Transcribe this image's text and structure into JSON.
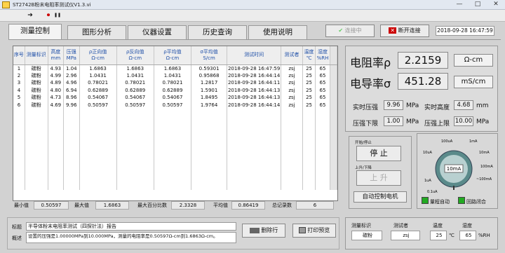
{
  "window": {
    "title": "ST2742B粉末电阻率测试仪V1.3.vi",
    "min": "—",
    "max": "□",
    "close": "✕"
  },
  "toolbar": {
    "run": "➔",
    "record": "⏺",
    "pause": "❚❚"
  },
  "tabs": [
    {
      "label": "测量控制",
      "active": true
    },
    {
      "label": "图形分析",
      "active": false
    },
    {
      "label": "仪器设置",
      "active": false
    },
    {
      "label": "历史查询",
      "active": false
    },
    {
      "label": "使用说明",
      "active": false
    }
  ],
  "connect_btn": "连接中",
  "disconnect_btn": "断开连接",
  "datetime": "2018-09-28 16:47:59",
  "table": {
    "headers": [
      "序号",
      "测量标识",
      "高度\nmm",
      "压强\nMPa",
      "ρ正向值\nΩ-cm",
      "ρ反向值\nΩ-cm",
      "ρ平均值\nΩ-cm",
      "σ平均值\nS/cm",
      "测试时间",
      "测试者",
      "温度\n℃",
      "湿度\n%RH"
    ],
    "rows": [
      [
        "1",
        "碳粉",
        "4.93",
        "1.04",
        "1.6863",
        "1.6863",
        "1.6863",
        "0.59301",
        "2018-09-28 16:47:59",
        "zsj",
        "25",
        "65"
      ],
      [
        "2",
        "碳粉",
        "4.99",
        "2.96",
        "1.0431",
        "1.0431",
        "1.0431",
        "0.95868",
        "2018-09-28 16:44:14",
        "zsj",
        "25",
        "65"
      ],
      [
        "3",
        "碳粉",
        "4.89",
        "4.96",
        "0.78021",
        "0.78021",
        "0.78021",
        "1.2817",
        "2018-09-28 16:44:11",
        "zsj",
        "25",
        "65"
      ],
      [
        "4",
        "碳粉",
        "4.80",
        "6.94",
        "0.62889",
        "0.62889",
        "0.62889",
        "1.5901",
        "2018-09-28 16:44:13",
        "zsj",
        "25",
        "65"
      ],
      [
        "5",
        "碳粉",
        "4.73",
        "8.96",
        "0.54067",
        "0.54067",
        "0.54067",
        "1.8495",
        "2018-09-28 16:44:13",
        "zsj",
        "25",
        "65"
      ],
      [
        "6",
        "碳粉",
        "4.69",
        "9.96",
        "0.50597",
        "0.50597",
        "0.50597",
        "1.9764",
        "2018-09-28 16:44:14",
        "zsj",
        "25",
        "65"
      ]
    ]
  },
  "stats": {
    "min_label": "最小值",
    "min": "0.50597",
    "max_label": "最大值",
    "max": "1.6863",
    "maxpct_label": "最大百分比数",
    "maxpct": "2.3328",
    "avg_label": "平均值",
    "avg": "0.86419",
    "count_label": "总记录数",
    "count": "6"
  },
  "report": {
    "title_label": "标题",
    "title": "半导体粉末电阻率测试（四探针法）报告",
    "summary_label": "概述",
    "summary": "设置的压强是1.00000MPa到10.000MPa，测量的电阻率是0.50597Ω-cm到1.6863Ω-cm。",
    "delete_btn": "删除行",
    "print_btn": "打印预览"
  },
  "readings": {
    "resistivity_label": "电阻率ρ",
    "resistivity": "2.2159",
    "resistivity_unit": "Ω-cm",
    "conductivity_label": "电导率σ",
    "conductivity": "451.28",
    "conductivity_unit": "mS/cm",
    "pressure_label": "实时压强",
    "pressure": "9.96",
    "pressure_unit": "MPa",
    "height_label": "实时高度",
    "height": "4.68",
    "height_unit": "mm",
    "pmin_label": "压强下限",
    "pmin": "1.00",
    "pmin_unit": "MPa",
    "pmax_label": "压强上限",
    "pmax": "10.00",
    "pmax_unit": "MPa"
  },
  "control": {
    "startstop_label": "开始/停止",
    "stop_btn": "停 止",
    "updown_label": "上升/下降",
    "up_btn": "上 升",
    "auto_label": "自动控制电机"
  },
  "dial": {
    "ticks": [
      "100uA",
      "1mA",
      "10mA",
      "100mA",
      "10uA",
      "1uA",
      "0.1uA",
      "~100mA"
    ],
    "value": "10mA",
    "auto_range": "量程自动",
    "loop_close": "回路闭合"
  },
  "sample": {
    "id_label": "测量标识",
    "id": "碳粉",
    "tester_label": "测试者",
    "tester": "zsj",
    "temp_label": "温度",
    "temp": "25",
    "temp_unit": "℃",
    "hum_label": "湿度",
    "hum": "65",
    "hum_unit": "%RH"
  }
}
